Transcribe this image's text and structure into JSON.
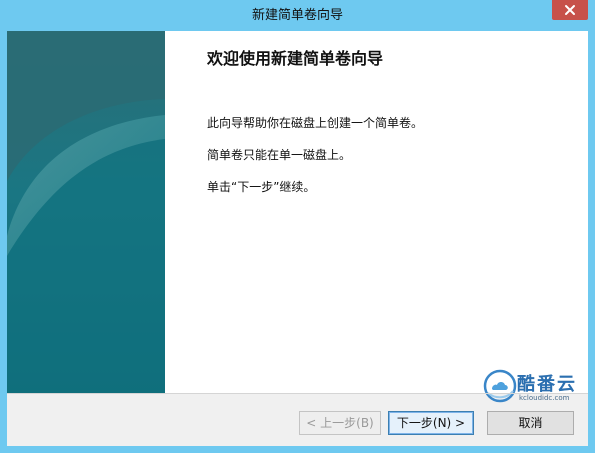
{
  "window": {
    "title": "新建简单卷向导",
    "close_glyph": "close-icon"
  },
  "wizard": {
    "heading": "欢迎使用新建简单卷向导",
    "paragraphs": [
      "此向导帮助你在磁盘上创建一个简单卷。",
      "简单卷只能在单一磁盘上。",
      "单击“下一步”继续。"
    ]
  },
  "buttons": {
    "back": "< 上一步(B)",
    "next": "下一步(N) >",
    "cancel": "取消"
  },
  "watermark": {
    "name": "酷番云",
    "domain": "kcloudidc.com"
  },
  "colors": {
    "titlebar": "#6ec9f0",
    "close_button": "#c7514a",
    "banner": "#13707d",
    "accent_border": "#3c7fb1"
  }
}
